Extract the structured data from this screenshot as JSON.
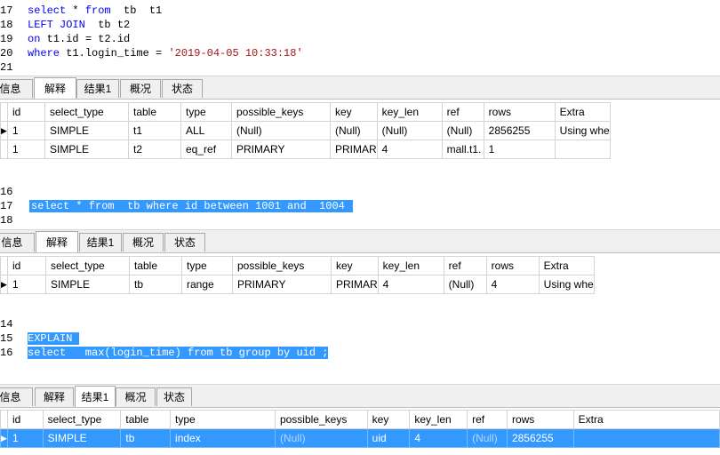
{
  "editor1": {
    "lines": [
      {
        "num": "17",
        "parts": [
          {
            "t": "select",
            "c": "kw"
          },
          {
            "t": " * ",
            "c": ""
          },
          {
            "t": "from",
            "c": "kw"
          },
          {
            "t": "  tb  t1",
            "c": ""
          }
        ]
      },
      {
        "num": "18",
        "parts": [
          {
            "t": "LEFT JOIN",
            "c": "kw"
          },
          {
            "t": "  tb t2",
            "c": ""
          }
        ]
      },
      {
        "num": "19",
        "parts": [
          {
            "t": "on",
            "c": "kw"
          },
          {
            "t": " t1.id = t2.id",
            "c": ""
          }
        ]
      },
      {
        "num": "20",
        "parts": [
          {
            "t": "where",
            "c": "kw"
          },
          {
            "t": " t1.login_time = ",
            "c": ""
          },
          {
            "t": "'2019-04-05 10:33:18'",
            "c": "str"
          }
        ]
      },
      {
        "num": "21",
        "parts": []
      }
    ]
  },
  "tabs1": {
    "items": [
      "信息",
      "解释",
      "结果1",
      "概况",
      "状态"
    ],
    "active": 1
  },
  "table1": {
    "headers": [
      "id",
      "select_type",
      "table",
      "type",
      "possible_keys",
      "key",
      "key_len",
      "ref",
      "rows",
      "Extra"
    ],
    "rows": [
      [
        "1",
        "SIMPLE",
        "t1",
        "ALL",
        "(Null)",
        "(Null)",
        "(Null)",
        "(Null)",
        "2856255",
        "Using whe"
      ],
      [
        "1",
        "SIMPLE",
        "t2",
        "eq_ref",
        "PRIMARY",
        "PRIMAR",
        "4",
        "mall.t1.",
        "1",
        ""
      ]
    ]
  },
  "editor2": {
    "lines": [
      {
        "num": "16",
        "text": ""
      },
      {
        "num": "17",
        "text": "select * from  tb where id between 1001 and  1004 "
      },
      {
        "num": "18",
        "text": ""
      }
    ]
  },
  "tabs2": {
    "items": [
      "信息",
      "解释",
      "结果1",
      "概况",
      "状态"
    ],
    "active": 1
  },
  "table2": {
    "headers": [
      "id",
      "select_type",
      "table",
      "type",
      "possible_keys",
      "key",
      "key_len",
      "ref",
      "rows",
      "Extra"
    ],
    "rows": [
      [
        "1",
        "SIMPLE",
        "tb",
        "range",
        "PRIMARY",
        "PRIMAR",
        "4",
        "(Null)",
        "4",
        "Using whe"
      ]
    ]
  },
  "editor3": {
    "lines": [
      {
        "num": "14",
        "text": ""
      },
      {
        "num": "15",
        "text": "EXPLAIN "
      },
      {
        "num": "16",
        "text": "select   max(login_time) from tb group by uid ;"
      }
    ]
  },
  "tabs3": {
    "items": [
      "信息",
      "解释",
      "结果1",
      "概况",
      "状态"
    ],
    "active": 2
  },
  "table3": {
    "headers": [
      "id",
      "select_type",
      "table",
      "type",
      "possible_keys",
      "key",
      "key_len",
      "ref",
      "rows",
      "Extra"
    ],
    "rows": [
      [
        "1",
        "SIMPLE",
        "tb",
        "index",
        "(Null)",
        "uid",
        "4",
        "(Null)",
        "2856255",
        ""
      ]
    ]
  },
  "colors": {
    "keyword": "#0000ff",
    "string": "#a31515",
    "selection": "#3399ff",
    "null_text": "#b3b3b3"
  }
}
